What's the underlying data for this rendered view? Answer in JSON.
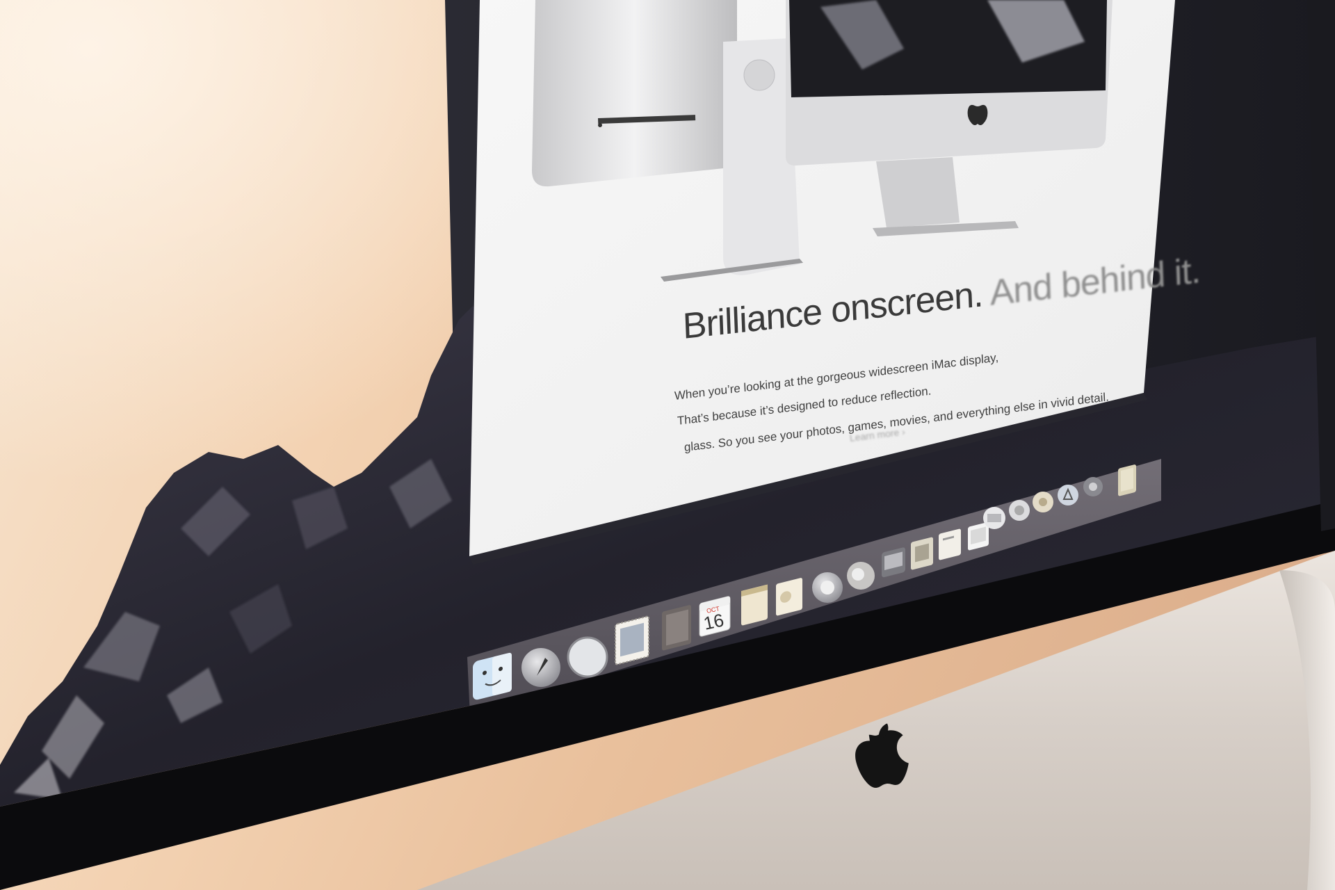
{
  "webpage": {
    "headline_main": "Brilliance onscreen.",
    "headline_faded": "And behind it.",
    "body_lines": [
      {
        "main": "When you’re looking at the gorgeous widescreen iMac display,",
        "faded": ""
      },
      {
        "main": "That’s because it’s designed to reduce reflection.",
        "faded": ""
      },
      {
        "main": "glass. So you see your photos, games, movies, and everything else in vivid detail.",
        "faded": ""
      }
    ],
    "learn_more": "Learn more ›"
  },
  "dock": {
    "calendar": {
      "month": "OCT",
      "day": "16"
    },
    "apps": [
      {
        "name": "Finder",
        "icon": "finder-icon"
      },
      {
        "name": "Launchpad",
        "icon": "rocket-icon"
      },
      {
        "name": "Safari",
        "icon": "compass-icon"
      },
      {
        "name": "Mail",
        "icon": "stamp-icon"
      },
      {
        "name": "Contacts",
        "icon": "address-book-icon"
      },
      {
        "name": "Calendar",
        "icon": "calendar-icon"
      },
      {
        "name": "Notes",
        "icon": "notes-icon"
      },
      {
        "name": "Reminders",
        "icon": "reminders-icon"
      },
      {
        "name": "Maps",
        "icon": "map-icon"
      },
      {
        "name": "Photos",
        "icon": "photos-icon"
      },
      {
        "name": "Messages",
        "icon": "messages-icon"
      },
      {
        "name": "FaceTime",
        "icon": "facetime-icon"
      },
      {
        "name": "Pages",
        "icon": "pages-icon"
      },
      {
        "name": "Numbers",
        "icon": "numbers-icon"
      },
      {
        "name": "Keynote",
        "icon": "keynote-icon"
      },
      {
        "name": "iTunes",
        "icon": "music-icon"
      },
      {
        "name": "iBooks",
        "icon": "book-icon"
      },
      {
        "name": "App Store",
        "icon": "app-store-icon"
      },
      {
        "name": "System Preferences",
        "icon": "gear-icon"
      },
      {
        "name": "Trash",
        "icon": "trash-icon"
      }
    ]
  },
  "colors": {
    "wall": "#f1cfae",
    "bezel": "#d6cfc9",
    "screen_border": "#0c0c0e",
    "dock_glass": "#5f5b63",
    "page_white": "#f4f4f4"
  }
}
